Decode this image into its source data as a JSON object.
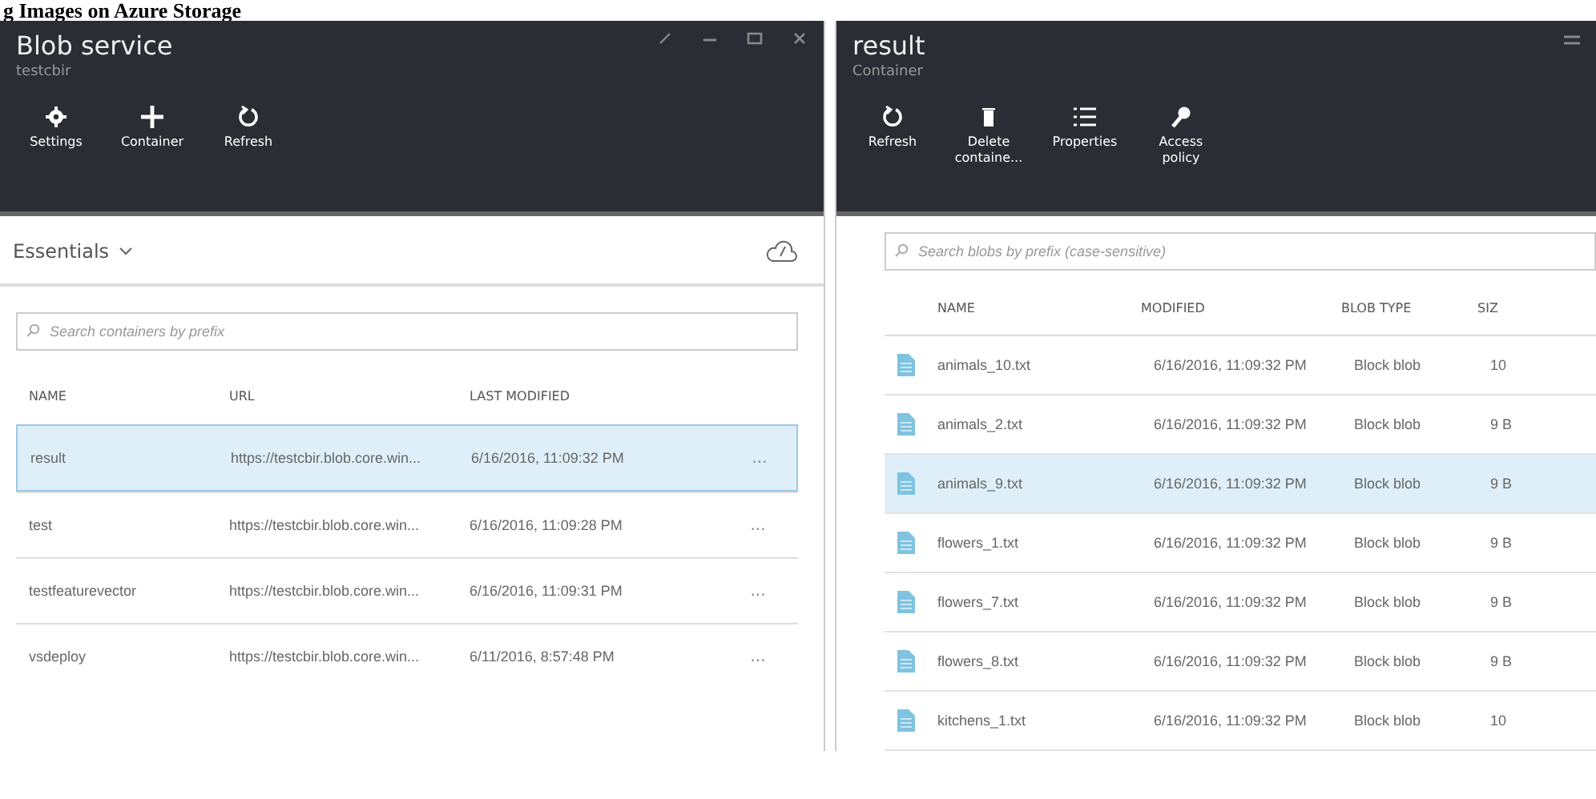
{
  "heading": "g Images on Azure Storage",
  "left": {
    "title": "Blob service",
    "subtitle": "testcbir",
    "commands": [
      {
        "kind": "gear",
        "label": "Settings"
      },
      {
        "kind": "plus",
        "label": "Container"
      },
      {
        "kind": "refresh",
        "label": "Refresh"
      }
    ],
    "essentials": "Essentials",
    "search": {
      "placeholder": "Search containers by prefix"
    },
    "columns": [
      "NAME",
      "URL",
      "LAST MODIFIED"
    ],
    "rows": [
      {
        "name": "result",
        "url": "https://testcbir.blob.core.win...",
        "modified": "6/16/2016, 11:09:32 PM",
        "more": "...",
        "selected": true
      },
      {
        "name": "test",
        "url": "https://testcbir.blob.core.win...",
        "modified": "6/16/2016, 11:09:28 PM",
        "more": "...",
        "selected": false
      },
      {
        "name": "testfeaturevector",
        "url": "https://testcbir.blob.core.win...",
        "modified": "6/16/2016, 11:09:31 PM",
        "more": "...",
        "selected": false
      },
      {
        "name": "vsdeploy",
        "url": "https://testcbir.blob.core.win...",
        "modified": "6/11/2016, 8:57:48 PM",
        "more": "...",
        "selected": false
      }
    ]
  },
  "right": {
    "title": "result",
    "subtitle": "Container",
    "commands": [
      {
        "kind": "refresh",
        "label": "Refresh"
      },
      {
        "kind": "trash",
        "label": "Delete containe..."
      },
      {
        "kind": "list",
        "label": "Properties"
      },
      {
        "kind": "key",
        "label": "Access policy"
      }
    ],
    "search": {
      "placeholder": "Search blobs by prefix (case-sensitive)"
    },
    "columns": [
      "NAME",
      "MODIFIED",
      "BLOB TYPE",
      "SIZ"
    ],
    "rows": [
      {
        "name": "animals_10.txt",
        "modified": "6/16/2016, 11:09:32 PM",
        "type": "Block blob",
        "size": "10",
        "selected": false
      },
      {
        "name": "animals_2.txt",
        "modified": "6/16/2016, 11:09:32 PM",
        "type": "Block blob",
        "size": "9 B",
        "selected": false
      },
      {
        "name": "animals_9.txt",
        "modified": "6/16/2016, 11:09:32 PM",
        "type": "Block blob",
        "size": "9 B",
        "selected": true
      },
      {
        "name": "flowers_1.txt",
        "modified": "6/16/2016, 11:09:32 PM",
        "type": "Block blob",
        "size": "9 B",
        "selected": false
      },
      {
        "name": "flowers_7.txt",
        "modified": "6/16/2016, 11:09:32 PM",
        "type": "Block blob",
        "size": "9 B",
        "selected": false
      },
      {
        "name": "flowers_8.txt",
        "modified": "6/16/2016, 11:09:32 PM",
        "type": "Block blob",
        "size": "9 B",
        "selected": false
      },
      {
        "name": "kitchens_1.txt",
        "modified": "6/16/2016, 11:09:32 PM",
        "type": "Block blob",
        "size": "10",
        "selected": false
      }
    ]
  }
}
